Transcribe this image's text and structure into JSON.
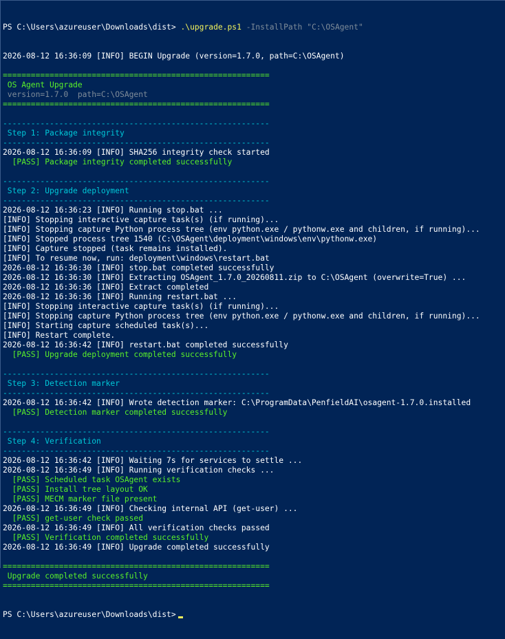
{
  "window": {
    "prompt": "PS C:\\Users\\azureuser\\Downloads\\dist>",
    "command_name": ".\\upgrade.ps1",
    "command_param": "-InstallPath",
    "command_value": "\"C:\\OSAgent\""
  },
  "colors": {
    "background": "#012456",
    "text": "#ffffff",
    "pass_green": "#5af02a",
    "header_cyan": "#00c8d8",
    "dim_gray": "#7f8c99",
    "command_yellow": "#f3f35d"
  },
  "lines": [
    "2026-08-12 16:36:09 [INFO] BEGIN Upgrade (version=1.7.0, path=C:\\OSAgent)",
    "",
    "=========================================================",
    " OS Agent Upgrade",
    " version=1.7.0  path=C:\\OSAgent",
    "=========================================================",
    "",
    "---------------------------------------------------------",
    " Step 1: Package integrity",
    "---------------------------------------------------------",
    "2026-08-12 16:36:09 [INFO] SHA256 integrity check started",
    "  [PASS] Package integrity completed successfully",
    "",
    "---------------------------------------------------------",
    " Step 2: Upgrade deployment",
    "---------------------------------------------------------",
    "2026-08-12 16:36:23 [INFO] Running stop.bat ...",
    "[INFO] Stopping interactive capture task(s) (if running)...",
    "[INFO] Stopping capture Python process tree (env python.exe / pythonw.exe and children, if running)...",
    "[INFO] Stopped process tree 1540 (C:\\OSAgent\\deployment\\windows\\env\\pythonw.exe)",
    "[INFO] Capture stopped (task remains installed).",
    "[INFO] To resume now, run: deployment\\windows\\restart.bat",
    "2026-08-12 16:36:30 [INFO] stop.bat completed successfully",
    "2026-08-12 16:36:30 [INFO] Extracting OSAgent_1.7.0_20260811.zip to C:\\OSAgent (overwrite=True) ...",
    "2026-08-12 16:36:36 [INFO] Extract completed",
    "2026-08-12 16:36:36 [INFO] Running restart.bat ...",
    "[INFO] Stopping interactive capture task(s) (if running)...",
    "[INFO] Stopping capture Python process tree (env python.exe / pythonw.exe and children, if running)...",
    "[INFO] Starting capture scheduled task(s)...",
    "[INFO] Restart complete.",
    "2026-08-12 16:36:42 [INFO] restart.bat completed successfully",
    "  [PASS] Upgrade deployment completed successfully",
    "",
    "---------------------------------------------------------",
    " Step 3: Detection marker",
    "---------------------------------------------------------",
    "2026-08-12 16:36:42 [INFO] Wrote detection marker: C:\\ProgramData\\PenfieldAI\\osagent-1.7.0.installed",
    "  [PASS] Detection marker completed successfully",
    "",
    "---------------------------------------------------------",
    " Step 4: Verification",
    "---------------------------------------------------------",
    "2026-08-12 16:36:42 [INFO] Waiting 7s for services to settle ...",
    "2026-08-12 16:36:49 [INFO] Running verification checks ...",
    "  [PASS] Scheduled task OSAgent exists",
    "  [PASS] Install tree layout OK",
    "  [PASS] MECM marker file present",
    "2026-08-12 16:36:49 [INFO] Checking internal API (get-user) ...",
    "  [PASS] get-user check passed",
    "2026-08-12 16:36:49 [INFO] All verification checks passed",
    "  [PASS] Verification completed successfully",
    "2026-08-12 16:36:49 [INFO] Upgrade completed successfully",
    "",
    "=========================================================",
    " Upgrade completed successfully",
    "========================================================="
  ],
  "line_styles": [
    "white",
    "white",
    "green",
    "green",
    "gray",
    "green",
    "white",
    "cyan",
    "cyan",
    "cyan",
    "white",
    "green",
    "white",
    "cyan",
    "cyan",
    "cyan",
    "white",
    "white",
    "white",
    "white",
    "white",
    "white",
    "white",
    "white",
    "white",
    "white",
    "white",
    "white",
    "white",
    "white",
    "white",
    "green",
    "white",
    "cyan",
    "cyan",
    "cyan",
    "white",
    "green",
    "white",
    "cyan",
    "cyan",
    "cyan",
    "white",
    "white",
    "green",
    "green",
    "green",
    "white",
    "green",
    "white",
    "green",
    "white",
    "white",
    "green",
    "green",
    "green"
  ]
}
